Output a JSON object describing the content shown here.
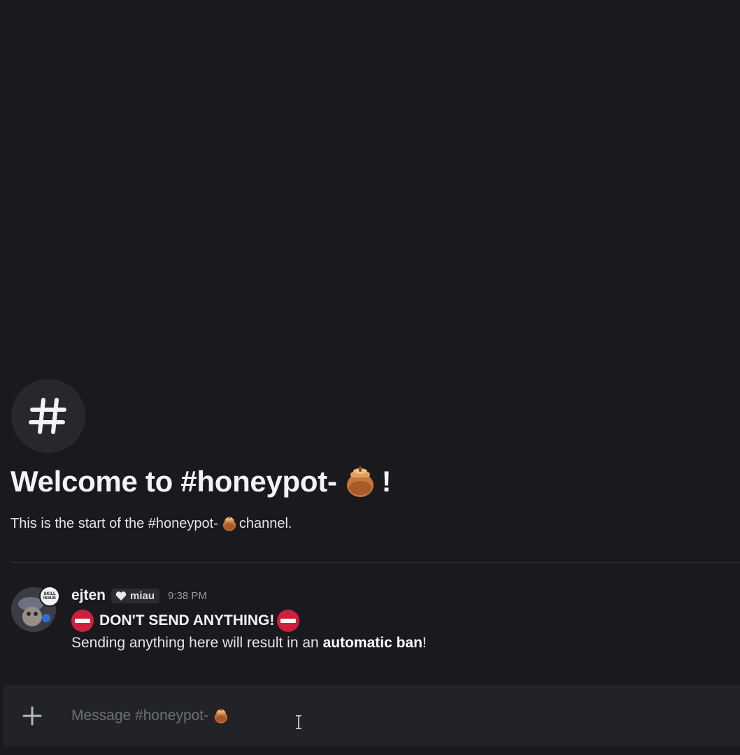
{
  "channel": {
    "welcome_title_prefix": "Welcome to #honeypot-",
    "welcome_title_suffix": "!",
    "welcome_sub_prefix": "This is the start of the #honeypot-",
    "welcome_sub_suffix": " channel."
  },
  "message": {
    "username": "ejten",
    "role_tag": "miau",
    "timestamp": "9:38 PM",
    "avatar_badge": "SKILL ISSUE",
    "line1": "DON'T SEND ANYTHING!",
    "line2_prefix": "Sending anything here will result in an ",
    "line2_bold": "automatic ban",
    "line2_suffix": "!"
  },
  "composer": {
    "placeholder": "Message #honeypot-"
  },
  "icons": {
    "channel": "hashtag-icon",
    "honeypot": "honey-pot-icon",
    "no_entry": "no-entry-icon",
    "heart": "heart-icon",
    "add": "plus-icon",
    "cursor": "text-cursor-icon"
  },
  "colors": {
    "background": "#1a1a1e",
    "composer": "#222327",
    "no_entry": "#d01f3c",
    "honey": "#c8763a"
  }
}
